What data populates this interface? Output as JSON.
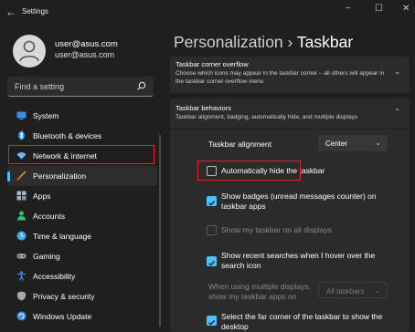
{
  "window": {
    "title": "Settings",
    "back_glyph": "←",
    "minimize_glyph": "−",
    "maximize_glyph": "☐",
    "close_glyph": "✕"
  },
  "profile": {
    "name": "user@asus.com",
    "email": "user@asus.com"
  },
  "search": {
    "placeholder": "Find a setting",
    "icon": "search-icon"
  },
  "sidebar": {
    "items": [
      {
        "label": "System",
        "icon": "monitor-icon",
        "color": "#3a8ee6",
        "active": false
      },
      {
        "label": "Bluetooth & devices",
        "icon": "bluetooth-icon",
        "color": "#2f8fe8",
        "active": false
      },
      {
        "label": "Network & internet",
        "icon": "wifi-icon",
        "color": "#6fb8ff",
        "active": false
      },
      {
        "label": "Personalization",
        "icon": "brush-icon",
        "color": "#e8a04a",
        "active": true
      },
      {
        "label": "Apps",
        "icon": "apps-icon",
        "color": "#a9b4c8",
        "active": false
      },
      {
        "label": "Accounts",
        "icon": "person-icon",
        "color": "#35c06f",
        "active": false
      },
      {
        "label": "Time & language",
        "icon": "globe-clock-icon",
        "color": "#4aa7e8",
        "active": false
      },
      {
        "label": "Gaming",
        "icon": "gamepad-icon",
        "color": "#9aa3ad",
        "active": false
      },
      {
        "label": "Accessibility",
        "icon": "accessibility-icon",
        "color": "#3a8ee6",
        "active": false
      },
      {
        "label": "Privacy & security",
        "icon": "shield-icon",
        "color": "#a8a8a8",
        "active": false
      },
      {
        "label": "Windows Update",
        "icon": "update-icon",
        "color": "#3a8ee6",
        "active": false
      }
    ]
  },
  "header": {
    "section": "Personalization",
    "separator": "›",
    "page": "Taskbar"
  },
  "overflow_card": {
    "title": "Taskbar corner overflow",
    "description": "Choose which icons may appear in the taskbar corner – all others will appear in the taskbar corner overflow menu",
    "chevron": "⌄"
  },
  "behaviors_card": {
    "title": "Taskbar behaviors",
    "description": "Taskbar alignment, badging, automatically hide, and multiple displays",
    "chevron": "⌃"
  },
  "settings": {
    "alignment": {
      "label": "Taskbar alignment",
      "value": "Center",
      "arrow": "⌄"
    },
    "auto_hide": {
      "label": "Automatically hide the taskbar",
      "checked": false
    },
    "badges": {
      "label": "Show badges (unread messages counter) on taskbar apps",
      "checked": true
    },
    "all_displays": {
      "label": "Show my taskbar on all displays",
      "checked": false,
      "disabled": true
    },
    "recent_searches": {
      "label": "Show recent searches when I hover over the search icon",
      "checked": true
    },
    "multi_display": {
      "label": "When using multiple displays, show my taskbar apps on",
      "value": "All taskbars",
      "arrow": "⌄",
      "disabled": true
    },
    "far_corner": {
      "label": "Select the far corner of the taskbar to show the desktop",
      "checked": true
    }
  },
  "colors": {
    "accent": "#4cc2ff",
    "highlight_outline": "#e2202f",
    "background": "#1f1f1f",
    "card": "#2b2b2b"
  }
}
